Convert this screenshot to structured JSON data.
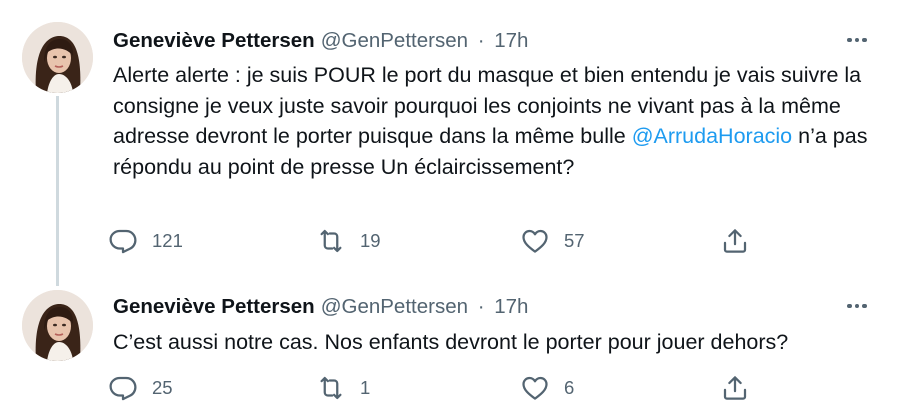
{
  "tweets": [
    {
      "author": {
        "name": "Geneviève Pettersen",
        "handle": "@GenPettersen",
        "time": "17h"
      },
      "text": {
        "part1": "Alerte alerte : je suis POUR le port du masque et bien entendu je vais suivre la consigne je veux juste savoir pourquoi les conjoints ne vivant pas à la même adresse devront le porter puisque dans la même bulle ",
        "mention": "@ArrudaHoracio",
        "part2": " n’a pas répondu au point de presse Un éclaircissement?"
      },
      "stats": {
        "replies": "121",
        "retweets": "19",
        "likes": "57"
      }
    },
    {
      "author": {
        "name": "Geneviève Pettersen",
        "handle": "@GenPettersen",
        "time": "17h"
      },
      "text": {
        "part1": "C’est aussi notre cas. Nos enfants devront le porter pour jouer dehors?"
      },
      "stats": {
        "replies": "25",
        "retweets": "1",
        "likes": "6"
      }
    }
  ],
  "separator": "·",
  "icons": [
    "more-icon",
    "reply-icon",
    "retweet-icon",
    "like-icon",
    "share-icon"
  ],
  "colors": {
    "text": "#0f1419",
    "secondary": "#536471",
    "link": "#1d9bf0",
    "thread_line": "#cfd9de"
  }
}
